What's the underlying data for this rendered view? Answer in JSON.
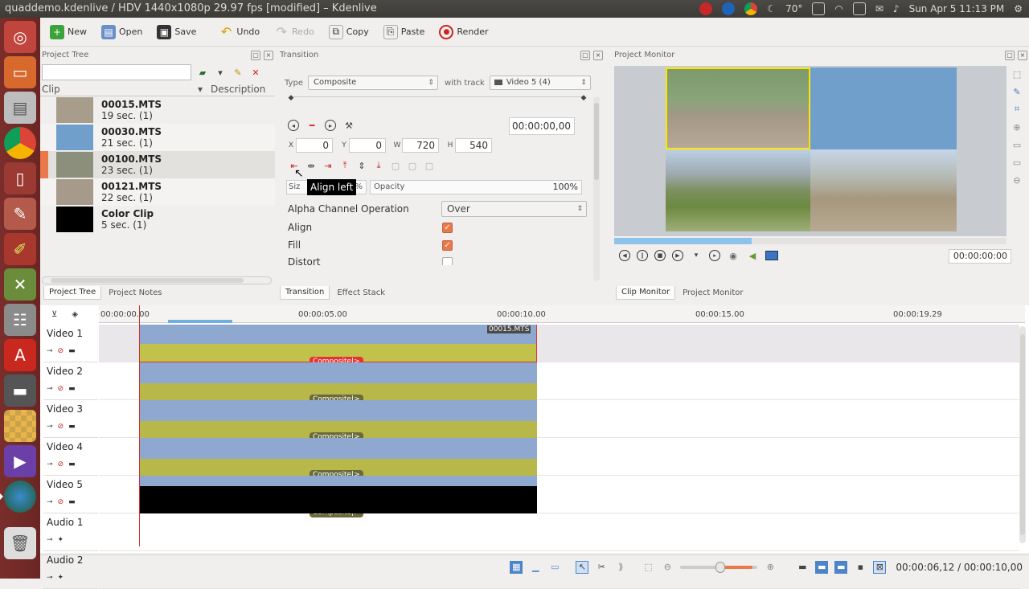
{
  "window": {
    "title": "quaddemo.kdenlive / HDV 1440x1080p 29.97 fps [modified] – Kdenlive"
  },
  "tray": {
    "temp": "70°",
    "clock": "Sun Apr 5 11:13 PM"
  },
  "toolbar": {
    "new": "New",
    "open": "Open",
    "save": "Save",
    "undo": "Undo",
    "redo": "Redo",
    "copy": "Copy",
    "paste": "Paste",
    "render": "Render"
  },
  "project_tree": {
    "title": "Project Tree",
    "col_clip": "Clip",
    "col_desc": "Description",
    "clips": [
      {
        "name": "00015.MTS",
        "dur": "19 sec. (1)"
      },
      {
        "name": "00030.MTS",
        "dur": "21 sec. (1)"
      },
      {
        "name": "00100.MTS",
        "dur": "23 sec. (1)"
      },
      {
        "name": "00121.MTS",
        "dur": "22 sec. (1)"
      },
      {
        "name": "Color Clip",
        "dur": "5 sec. (1)"
      }
    ],
    "tabs": [
      "Project Tree",
      "Project Notes"
    ]
  },
  "transition": {
    "title": "Transition",
    "type_label": "Type",
    "type_value": "Composite",
    "with_track_label": "with track",
    "with_track_value": "Video 5 (4)",
    "timecode": "00:00:00,00",
    "x_label": "X",
    "x": "0",
    "y_label": "Y",
    "y": "0",
    "w_label": "W",
    "w": "720",
    "h_label": "H",
    "h": "540",
    "size_label": "Siz",
    "size_suffix": "%",
    "opacity_label": "Opacity",
    "opacity_value": "100%",
    "tooltip": "Align left",
    "alpha_label": "Alpha Channel Operation",
    "alpha_value": "Over",
    "align_label": "Align",
    "fill_label": "Fill",
    "distort_label": "Distort",
    "align_checked": true,
    "fill_checked": true,
    "distort_checked": false,
    "tabs": [
      "Transition",
      "Effect Stack"
    ]
  },
  "monitor": {
    "title": "Project Monitor",
    "timecode": "00:00:00:00",
    "tabs": [
      "Clip Monitor",
      "Project Monitor"
    ],
    "progress": 0.35
  },
  "timeline": {
    "ruler": [
      "00:00:00.00",
      "00:00:05.00",
      "00:00:10.00",
      "00:00:15.00",
      "00:00:19.29"
    ],
    "tracks": [
      "Video 1",
      "Video 2",
      "Video 3",
      "Video 4",
      "Video 5",
      "Audio 1",
      "Audio 2"
    ],
    "clip_label": "00015.MTS",
    "composite": "Composite|>"
  },
  "status": {
    "position": "00:00:06,12 / 00:00:10,00"
  },
  "colors": {
    "accent": "#e9794a",
    "clip_blue": "#8fa8cf",
    "transition_yellow": "#b8b84a",
    "selected_red": "#e8322d",
    "launcher": "#722a27"
  }
}
